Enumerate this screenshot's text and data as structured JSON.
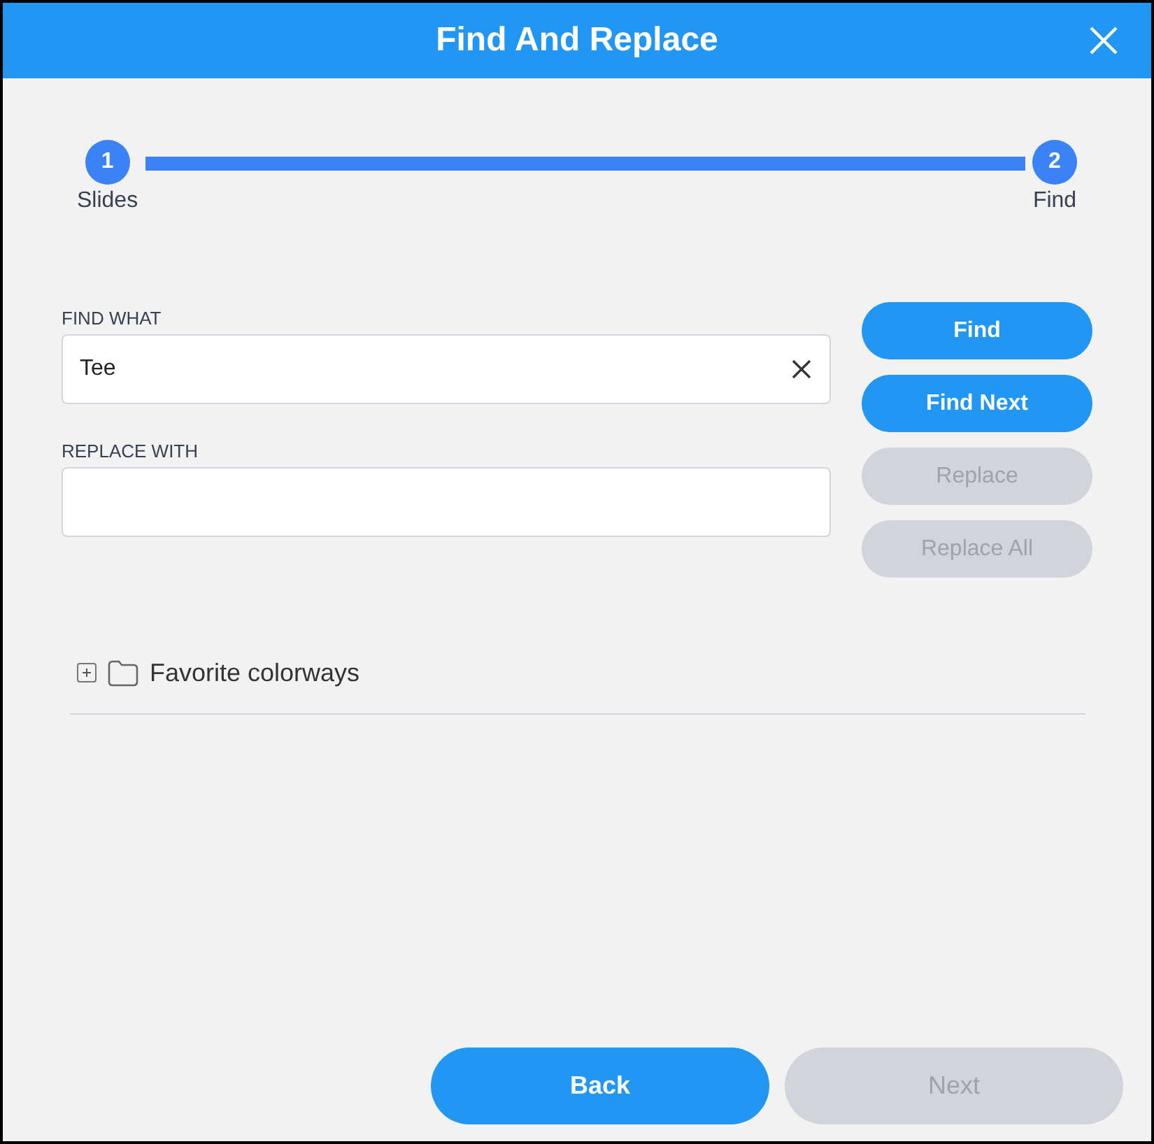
{
  "window": {
    "title": "Find And Replace"
  },
  "stepper": {
    "steps": [
      {
        "number": "1",
        "label": "Slides",
        "completed": true
      },
      {
        "number": "2",
        "label": "Find",
        "completed": true
      }
    ]
  },
  "fields": [
    {
      "label": "FIND WHAT",
      "value": "Tee",
      "clearable": true
    },
    {
      "label": "REPLACE WITH",
      "clearable": false
    }
  ],
  "action_buttons": [
    {
      "label": "Find",
      "disabled": false
    },
    {
      "label": "Find Next",
      "disabled": false
    },
    {
      "label": "Replace",
      "disabled": true
    },
    {
      "label": "Replace All",
      "disabled": true
    }
  ],
  "tree": [
    {
      "label": "Favorite colorways",
      "expanded": false
    }
  ],
  "footer_buttons": [
    {
      "label": "Back",
      "disabled": false
    },
    {
      "label": "Next",
      "disabled": true
    }
  ]
}
